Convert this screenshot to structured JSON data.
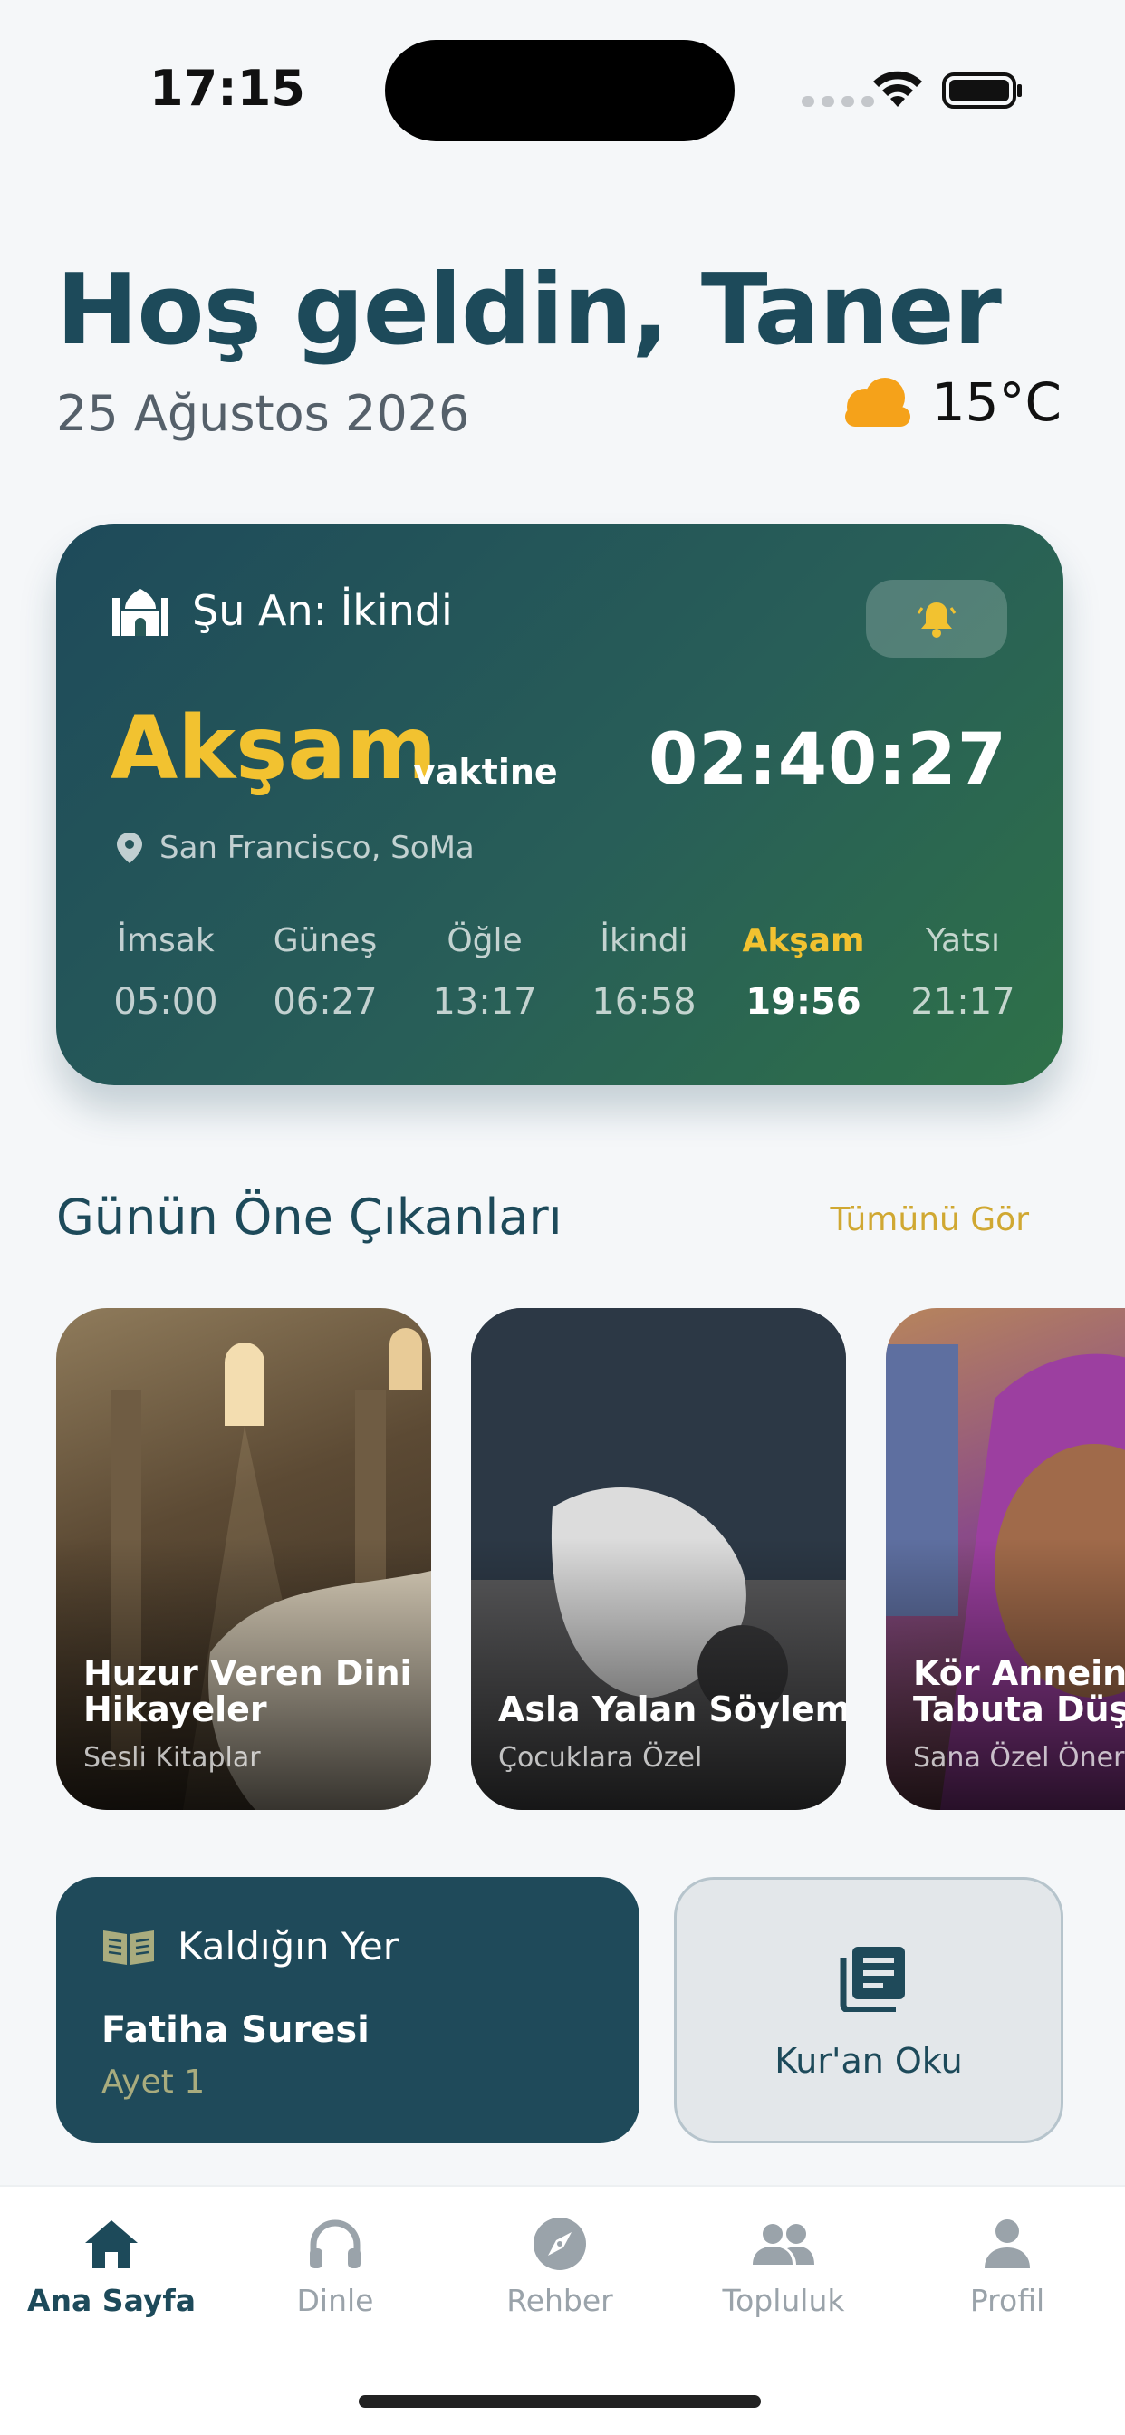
{
  "status": {
    "time": "17:15"
  },
  "header": {
    "greeting": "Hoş geldin, Taner",
    "date": "25 Ağustos 2026",
    "temperature": "15°C",
    "weather_icon": "cloud-icon"
  },
  "prayer_card": {
    "current": "Şu An: İkindi",
    "next_prayer": "Akşam",
    "next_suffix": "vaktine",
    "countdown": "02:40:27",
    "location": "San Francisco, SoMa",
    "accent_color": "#f2c230",
    "times": [
      {
        "name": "İmsak",
        "time": "05:00",
        "active": false
      },
      {
        "name": "Güneş",
        "time": "06:27",
        "active": false
      },
      {
        "name": "Öğle",
        "time": "13:17",
        "active": false
      },
      {
        "name": "İkindi",
        "time": "16:58",
        "active": false
      },
      {
        "name": "Akşam",
        "time": "19:56",
        "active": true
      },
      {
        "name": "Yatsı",
        "time": "21:17",
        "active": false
      }
    ]
  },
  "highlights": {
    "title": "Günün Öne Çıkanları",
    "see_all": "Tümünü Gör",
    "cards": [
      {
        "title_line1": "Huzur Veren Dini",
        "title_line2": "Hikayeler",
        "subtitle": "Sesli Kitaplar"
      },
      {
        "title_line1": "",
        "title_line2": "Asla Yalan Söyleme",
        "subtitle": "Çocuklara Özel"
      },
      {
        "title_line1": "Kör Annein G",
        "title_line2": "Tabuta Düştü",
        "subtitle": "Sana Özel Öner"
      }
    ]
  },
  "resume": {
    "label": "Kaldığın Yer",
    "surah": "Fatiha Suresi",
    "ayah": "Ayet 1"
  },
  "quran": {
    "label": "Kur'an Oku"
  },
  "tabs": [
    {
      "label": "Ana Sayfa",
      "icon": "home-icon",
      "active": true
    },
    {
      "label": "Dinle",
      "icon": "headphones-icon",
      "active": false
    },
    {
      "label": "Rehber",
      "icon": "compass-icon",
      "active": false
    },
    {
      "label": "Topluluk",
      "icon": "people-icon",
      "active": false
    },
    {
      "label": "Profil",
      "icon": "person-icon",
      "active": false
    }
  ]
}
